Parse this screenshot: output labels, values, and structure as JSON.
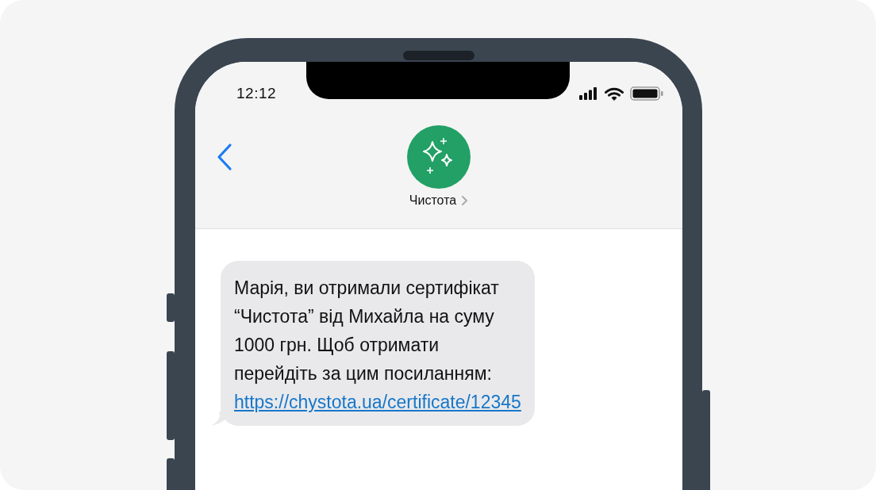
{
  "status_bar": {
    "time": "12:12"
  },
  "contact": {
    "name": "Чистота"
  },
  "messages": [
    {
      "kind": "incoming",
      "lines": [
        "Марія, ви отримали сертифікат",
        "“Чистота” від Михайла на суму",
        "1000 грн. Щоб отримати",
        "перейдіть за цим посиланням:"
      ],
      "link": "https://chystota.ua/certificate/12345"
    }
  ]
}
